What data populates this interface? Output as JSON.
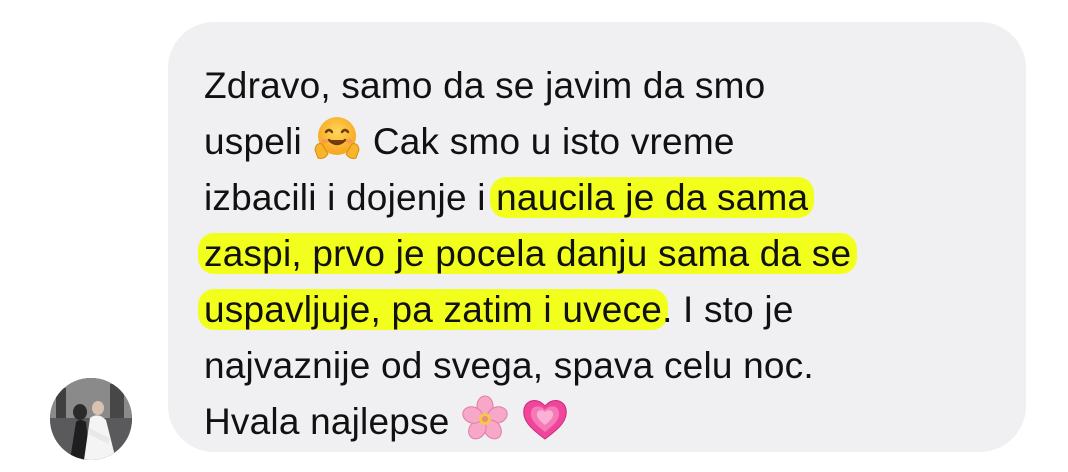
{
  "message": {
    "line1": "Zdravo, samo da se javim da smo",
    "line2_a": "uspeli",
    "line2_emoji": "hugging-face-icon",
    "line2_b": "Cak smo u isto vreme",
    "line3_a": "izbacili i dojenje i",
    "line3_hl": "naucila je da sama",
    "line4_hl": "zaspi, prvo je pocela danju sama da se",
    "line5_hl": "uspavljuje, pa zatim i uvece",
    "line5_b": ". I sto je",
    "line6": "najvaznije od svega, spava celu noc.",
    "line7": "Hvala najlepse",
    "line7_emojis": [
      "cherry-blossom-icon",
      "growing-heart-icon"
    ]
  },
  "colors": {
    "bubble": "#f0f0f2",
    "highlight": "#f2ff1c",
    "text": "#111111"
  }
}
